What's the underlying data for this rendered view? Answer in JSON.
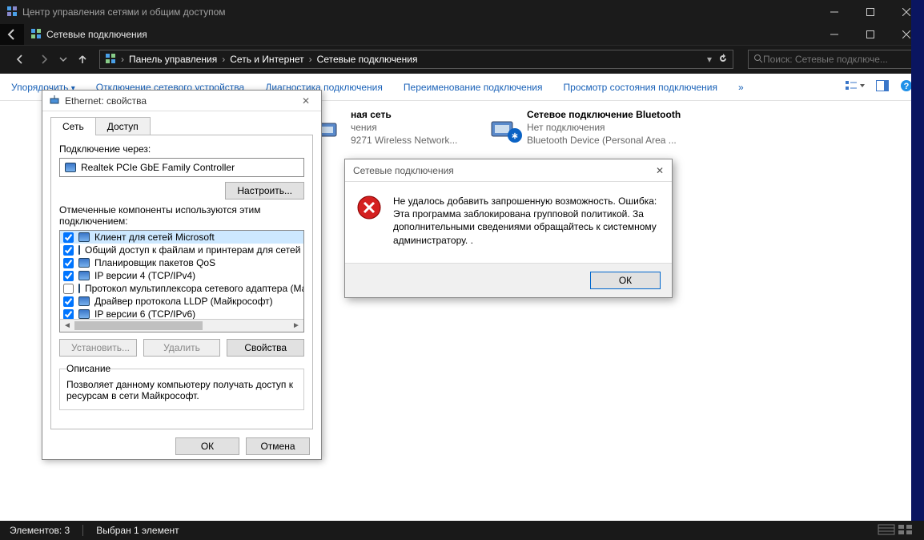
{
  "outer_window": {
    "title": "Центр управления сетями и общим доступом"
  },
  "inner_window": {
    "title": "Сетевые подключения"
  },
  "breadcrumbs": {
    "b0": "Панель управления",
    "b1": "Сеть и Интернет",
    "b2": "Сетевые подключения"
  },
  "search": {
    "placeholder": "Поиск: Сетевые подключе..."
  },
  "toolbar": {
    "organize": "Упорядочить",
    "disable": "Отключение сетевого устройства",
    "diagnose": "Диагностика подключения",
    "rename": "Переименование подключения",
    "status": "Просмотр состояния подключения",
    "more": "»"
  },
  "connections": {
    "wifi": {
      "name": "ная сеть",
      "line2": "чения",
      "line3": "9271 Wireless Network..."
    },
    "bt": {
      "name": "Сетевое подключение Bluetooth",
      "line2": "Нет подключения",
      "line3": "Bluetooth Device (Personal Area ..."
    }
  },
  "statusbar": {
    "count": "Элементов: 3",
    "selected": "Выбран 1 элемент"
  },
  "props": {
    "title": "Ethernet: свойства",
    "tab_network": "Сеть",
    "tab_access": "Доступ",
    "connect_via": "Подключение через:",
    "adapter": "Realtek PCIe GbE Family Controller",
    "configure": "Настроить...",
    "components_label": "Отмеченные компоненты используются этим подключением:",
    "components": [
      {
        "checked": true,
        "label": "Клиент для сетей Microsoft",
        "selected": true
      },
      {
        "checked": true,
        "label": "Общий доступ к файлам и принтерам для сетей Mi"
      },
      {
        "checked": true,
        "label": "Планировщик пакетов QoS"
      },
      {
        "checked": true,
        "label": "IP версии 4 (TCP/IPv4)"
      },
      {
        "checked": false,
        "label": "Протокол мультиплексора сетевого адаптера (Ма"
      },
      {
        "checked": true,
        "label": "Драйвер протокола LLDP (Майкрософт)"
      },
      {
        "checked": true,
        "label": "IP версии 6 (TCP/IPv6)"
      }
    ],
    "install": "Установить...",
    "uninstall": "Удалить",
    "properties": "Свойства",
    "desc_label": "Описание",
    "desc_text": "Позволяет данному компьютеру получать доступ к ресурсам в сети Майкрософт.",
    "ok": "ОК",
    "cancel": "Отмена"
  },
  "msgbox": {
    "title": "Сетевые подключения",
    "text": "Не удалось добавить запрошенную возможность. Ошибка: Эта программа заблокирована групповой политикой. За дополнительными сведениями обращайтесь к системному администратору.\n.",
    "ok": "ОК"
  }
}
